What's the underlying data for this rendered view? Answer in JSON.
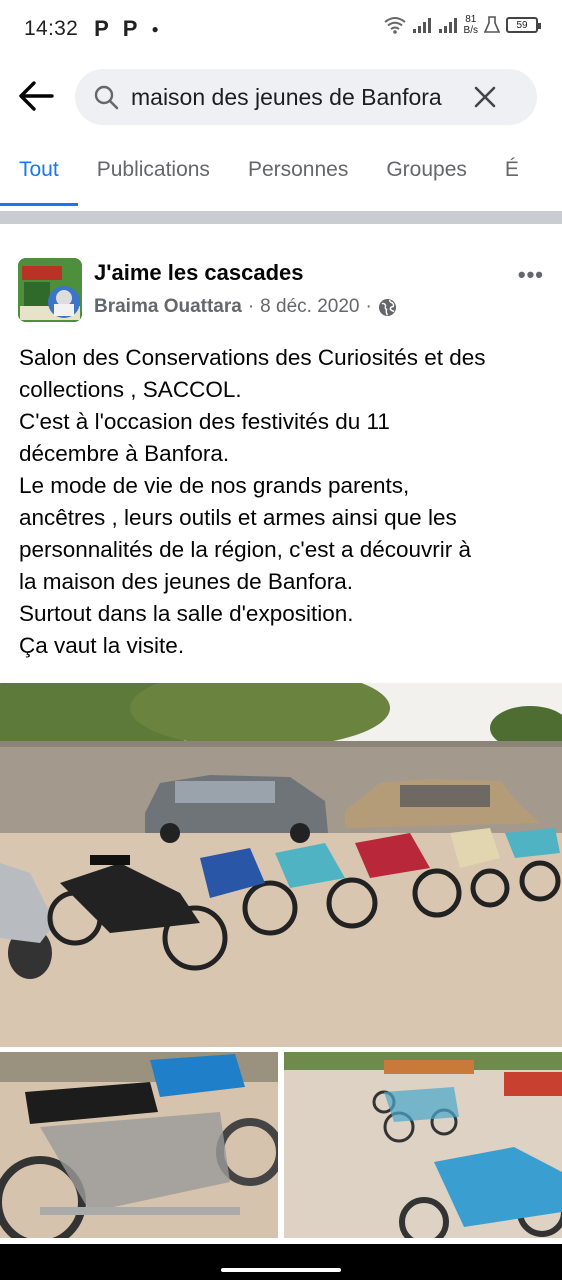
{
  "status_bar": {
    "time": "14:32",
    "app_icons": [
      "P",
      "P"
    ],
    "net_speed_value": "81",
    "net_speed_unit": "B/s",
    "battery": "59"
  },
  "search": {
    "query": "maison des jeunes de Banfora"
  },
  "tabs": [
    {
      "label": "Tout",
      "active": true
    },
    {
      "label": "Publications",
      "active": false
    },
    {
      "label": "Personnes",
      "active": false
    },
    {
      "label": "Groupes",
      "active": false
    },
    {
      "label": "É",
      "active": false
    }
  ],
  "post": {
    "page_name": "J'aime les cascades",
    "author": "Braima Ouattara",
    "separator": "·",
    "date": "8 déc. 2020",
    "more": "•••",
    "lines": [
      "Salon des Conservations des Curiosités et des",
      "collections , SACCOL.",
      "C'est à l'occasion des festivités du 11",
      "décembre à Banfora.",
      "Le mode de vie de nos grands parents,",
      "ancêtres , leurs outils et armes ainsi que les",
      "personnalités de la région, c'est a découvrir à",
      "la maison des jeunes de Banfora.",
      "Surtout dans la salle d'exposition.",
      "Ça vaut la visite."
    ]
  },
  "colors": {
    "accent": "#1877f2",
    "secondary_text": "#65676b",
    "search_bg": "#eef0f3",
    "divider": "#c9ccd1"
  },
  "icons": {
    "back": "arrow-left-icon",
    "search": "search-icon",
    "clear": "close-icon",
    "globe": "globe-icon",
    "more": "more-horizontal-icon"
  }
}
